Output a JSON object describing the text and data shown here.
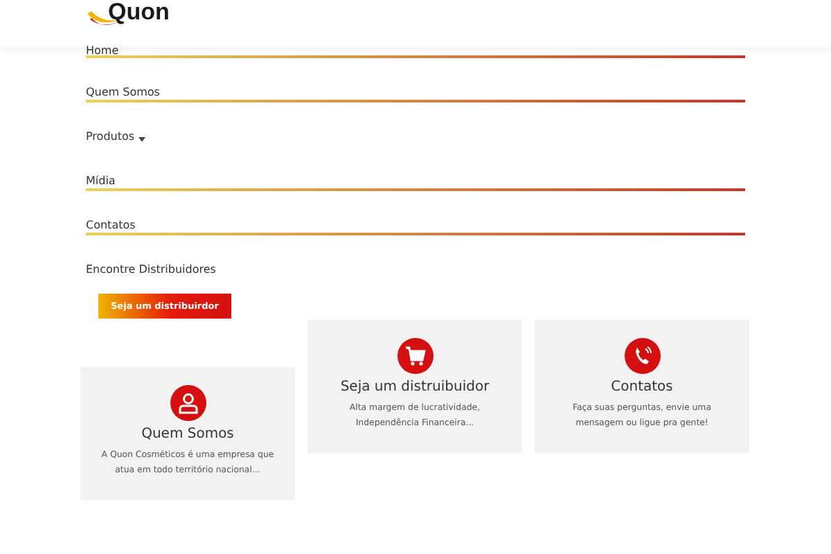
{
  "logo": {
    "text": "Quon"
  },
  "menu": [
    {
      "label": "Home",
      "underline": true,
      "submenu": false
    },
    {
      "label": "Quem Somos",
      "underline": true,
      "submenu": false
    },
    {
      "label": "Produtos",
      "underline": false,
      "submenu": true
    },
    {
      "label": "Mídia",
      "underline": true,
      "submenu": false
    },
    {
      "label": "Contatos",
      "underline": true,
      "submenu": false
    },
    {
      "label": "Encontre Distribuidores",
      "underline": false,
      "submenu": false
    }
  ],
  "cta_button": "Seja um distribuirdor",
  "cards": [
    {
      "kind": "person",
      "title": "Quem Somos",
      "text": "A Quon Cosméticos é uma empresa que atua em todo território nacional..."
    },
    {
      "kind": "cart",
      "title": "Seja um distruibuidor",
      "text": "Alta margem de lucratividade, Independência Financeira..."
    },
    {
      "kind": "phone",
      "title": "Contatos",
      "text": "Faça suas perguntas, envie uma mensagem ou ligue pra gente!"
    }
  ]
}
